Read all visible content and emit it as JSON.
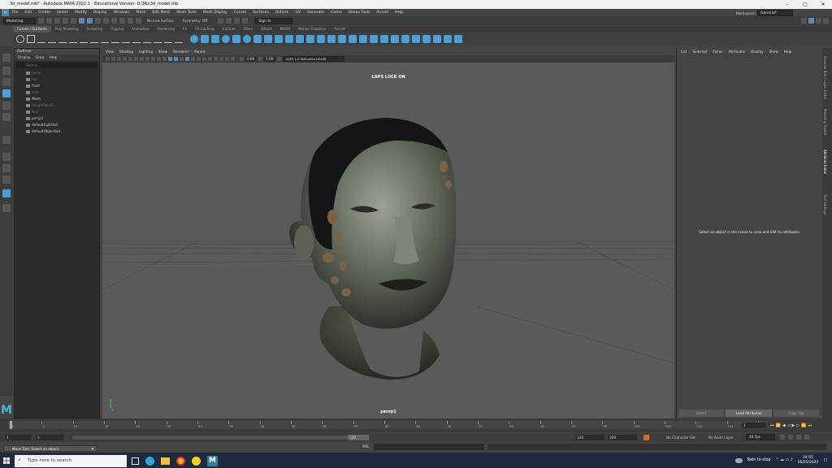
{
  "window": {
    "title": "3d_model.mb* - Autodesk MAYA 2022.1 - Educational Version: D:\\Mu\\3d_model.mb",
    "minimize": "–",
    "maximize": "□",
    "close": "✕"
  },
  "menubar": [
    "File",
    "Edit",
    "Create",
    "Select",
    "Modify",
    "Display",
    "Windows",
    "Mesh",
    "Edit Mesh",
    "Mesh Tools",
    "Mesh Display",
    "Curves",
    "Surfaces",
    "Deform",
    "UV",
    "Generate",
    "Cache",
    "Bonus Tools",
    "Arnold",
    "Help"
  ],
  "workspace": {
    "label": "Workspace:",
    "value": "General*"
  },
  "statusline": {
    "mode": "Modeling",
    "live_surface": "No Live Surface",
    "symmetry": "Symmetry: Off",
    "sign_in": "Sign In"
  },
  "shelf_tabs": [
    "Curves / Surfaces",
    "Poly Modeling",
    "Sculpting",
    "Rigging",
    "Animation",
    "Rendering",
    "FX",
    "FX Caching",
    "Custom",
    "XGen",
    "Bifrost",
    "MASH",
    "Motion Graphics",
    "Arnold"
  ],
  "outliner": {
    "title": "Outliner",
    "menu": [
      "Display",
      "Show",
      "Help"
    ],
    "search_placeholder": "Search...",
    "items": [
      {
        "label": "persp",
        "dim": true
      },
      {
        "label": "top",
        "dim": true
      },
      {
        "label": "front",
        "dim": false
      },
      {
        "label": "side",
        "dim": true
      },
      {
        "label": "Mesh",
        "dim": false
      },
      {
        "label": "imagePlane1",
        "dim": true
      },
      {
        "label": "Null",
        "dim": true
      },
      {
        "label": "persp1",
        "dim": false
      },
      {
        "label": "defaultLightSet",
        "dim": false
      },
      {
        "label": "defaultObjectSet",
        "dim": false
      }
    ]
  },
  "viewport": {
    "menu": [
      "View",
      "Shading",
      "Lighting",
      "Show",
      "Renderer",
      "Panels"
    ],
    "exposure": "0.00",
    "gamma": "1.00",
    "colorspace": "ACES 1.0 SDR-video (sRGB)",
    "caps_lock": "CAPS LOCK ON",
    "camera": "persp1"
  },
  "attribute_editor": {
    "menu": [
      "List",
      "Selected",
      "Focus",
      "Attributes",
      "Display",
      "Show",
      "Help"
    ],
    "message": "Select an object in the scene to view and edit its attributes",
    "buttons": [
      "Select",
      "Load Attributes",
      "Copy Tab"
    ]
  },
  "side_tabs": [
    "Channel Box / Layer Editor",
    "Modeling Toolkit",
    "Attribute Editor",
    "Tool Settings"
  ],
  "time": {
    "ticks": [
      "1",
      "5",
      "10",
      "15",
      "20",
      "25",
      "30",
      "35",
      "40",
      "45",
      "50",
      "55",
      "60",
      "65",
      "70",
      "75",
      "80",
      "85",
      "90",
      "95",
      "100",
      "105",
      "110",
      "115",
      "120"
    ],
    "current": "1",
    "range_start": "1",
    "range_inner_start": "1",
    "range_inner_end": "120",
    "range_end_a": "120",
    "range_end_b": "200",
    "character_set": "No Character Set",
    "anim_layer": "No Anim Layer",
    "fps": "24 fps"
  },
  "cmdline": {
    "lang": "MEL",
    "help": "Move Tool: Select an object"
  },
  "taskbar": {
    "search_placeholder": "Type here to search",
    "weather": "Rain to stop",
    "time": "14:55",
    "date": "16/05/2022"
  }
}
